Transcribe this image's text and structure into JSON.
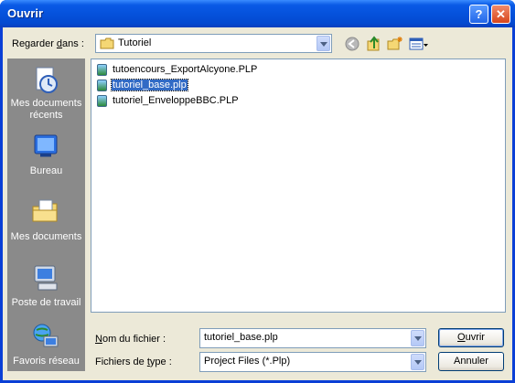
{
  "window": {
    "title": "Ouvrir",
    "help_label": "?",
    "close_label": "✕"
  },
  "lookin": {
    "label_pre": "Regarder ",
    "label_key": "d",
    "label_post": "ans :",
    "value": "Tutoriel"
  },
  "places": [
    {
      "label": "Mes documents récents",
      "icon": "recent-documents-icon"
    },
    {
      "label": "Bureau",
      "icon": "desktop-icon"
    },
    {
      "label": "Mes documents",
      "icon": "my-documents-icon"
    },
    {
      "label": "Poste de travail",
      "icon": "my-computer-icon"
    },
    {
      "label": "Favoris réseau",
      "icon": "network-places-icon"
    }
  ],
  "files": [
    {
      "name": "tutoencours_ExportAlcyone.PLP",
      "selected": false
    },
    {
      "name": "tutoriel_base.plp",
      "selected": true
    },
    {
      "name": "tutoriel_EnveloppeBBC.PLP",
      "selected": false
    }
  ],
  "filename": {
    "label_key": "N",
    "label_post": "om du fichier :",
    "value": "tutoriel_base.plp"
  },
  "filetype": {
    "label_pre": "Fichiers de ",
    "label_key": "t",
    "label_post": "ype :",
    "value": "Project Files (*.Plp)"
  },
  "buttons": {
    "open_key": "O",
    "open_post": "uvrir",
    "cancel": "Annuler"
  },
  "colors": {
    "title_bar": "#0552dc",
    "places_bar": "#8a8a8a",
    "selection": "#316ac5",
    "dialog_bg": "#ece9d8"
  }
}
